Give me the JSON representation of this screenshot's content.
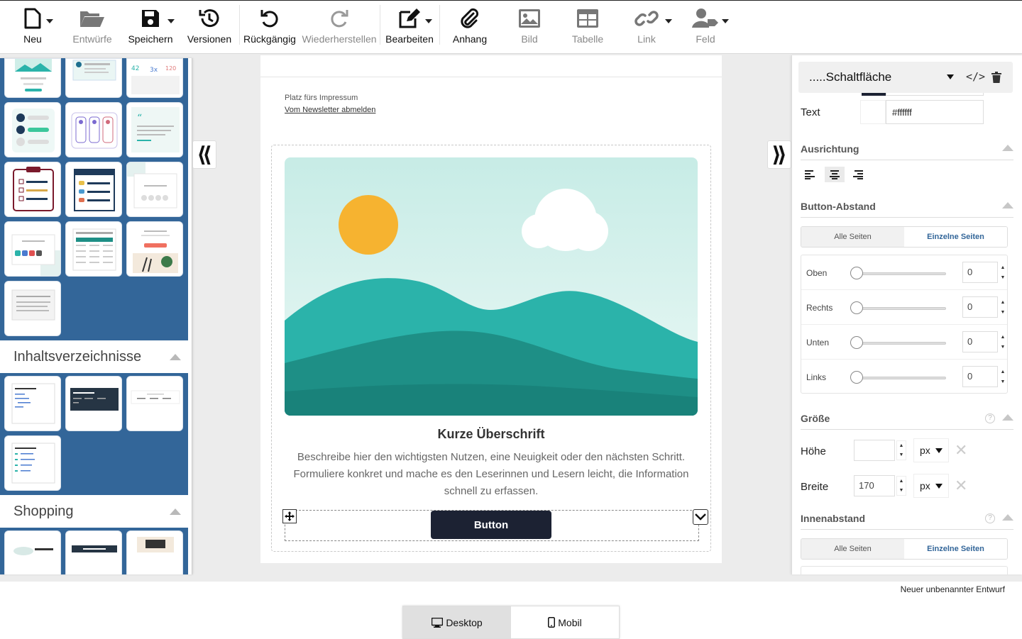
{
  "toolbar": {
    "new": "Neu",
    "drafts": "Entwürfe",
    "save": "Speichern",
    "versions": "Versionen",
    "undo": "Rückgängig",
    "redo": "Wiederherstellen",
    "edit": "Bearbeiten",
    "attachment": "Anhang",
    "image": "Bild",
    "table": "Tabelle",
    "link": "Link",
    "field": "Feld"
  },
  "left_panel": {
    "sections": [
      "Inhaltsverzeichnisse",
      "Shopping"
    ]
  },
  "canvas": {
    "impressum": "Platz fürs Impressum",
    "unsubscribe": "Vom Newsletter abmelden",
    "headline": "Kurze Überschrift",
    "body": "Beschreibe hier den wichtigsten Nutzen, eine Neuigkeit oder den nächsten Schritt. Formuliere konkret und mache es den Leserinnen und Lesern leicht, die Information schnell zu erfassen.",
    "button": "Button"
  },
  "right_panel": {
    "element": ".....Schaltfläche",
    "text_label": "Text",
    "text_color": "#ffffff",
    "alignment": "Ausrichtung",
    "button_spacing": "Button-Abstand",
    "all_sides": "Alle Seiten",
    "single_sides": "Einzelne Seiten",
    "sides": [
      {
        "label": "Oben",
        "value": "0"
      },
      {
        "label": "Rechts",
        "value": "0"
      },
      {
        "label": "Unten",
        "value": "0"
      },
      {
        "label": "Links",
        "value": "0"
      }
    ],
    "size": "Größe",
    "height_label": "Höhe",
    "height_value": "",
    "width_label": "Breite",
    "width_value": "170",
    "unit": "px",
    "padding": "Innenabstand"
  },
  "footer": {
    "draft_name": "Neuer unbenannter Entwurf",
    "desktop": "Desktop",
    "mobile": "Mobil"
  },
  "colors": {
    "brand_blue": "#336699",
    "button_dark": "#1c2233",
    "teal_dark": "#1e8f86",
    "teal_light": "#2bb3aa",
    "sky": "#d4efea",
    "sun": "#f6b330"
  }
}
